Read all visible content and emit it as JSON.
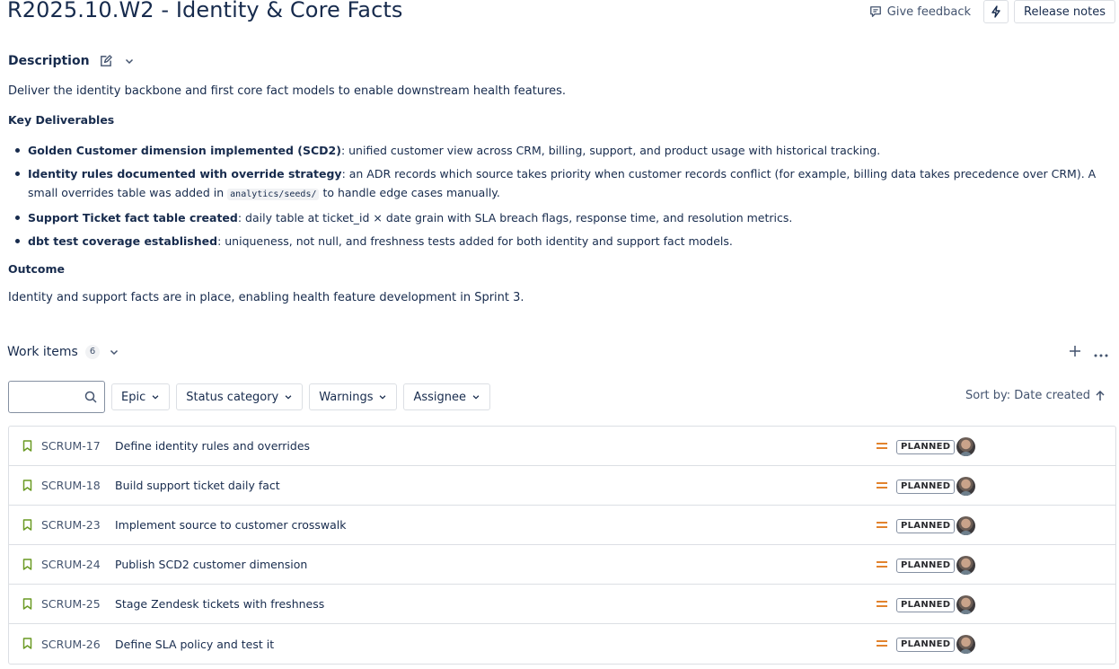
{
  "page": {
    "title": "R2025.10.W2 - Identity & Core Facts",
    "feedback_label": "Give feedback",
    "release_notes_label": "Release notes"
  },
  "description": {
    "label": "Description",
    "intro": "Deliver the identity backbone and first core fact models to enable downstream health features.",
    "key_deliverables_heading": "Key Deliverables",
    "bullets": [
      {
        "bold": "Golden Customer dimension implemented (SCD2)",
        "text": ": unified customer view across CRM, billing, support, and product usage with historical tracking."
      },
      {
        "bold": "Identity rules documented with override strategy",
        "text": ": an ADR records which source takes priority when customer records conflict (for example, billing data takes precedence over CRM). A small overrides table was added in ",
        "code": "analytics/seeds/",
        "text_after": " to handle edge cases manually."
      },
      {
        "bold": "Support Ticket fact table created",
        "text": ": daily table at ticket_id × date grain with SLA breach flags, response time, and resolution metrics."
      },
      {
        "bold": "dbt test coverage established",
        "text": ": uniqueness, not null, and freshness tests added for both identity and support fact models."
      }
    ],
    "outcome_heading": "Outcome",
    "outcome_text": "Identity and support facts are in place, enabling health feature development in Sprint 3."
  },
  "work_items": {
    "title": "Work items",
    "count": "6",
    "search_value": "",
    "filters": [
      "Epic",
      "Status category",
      "Warnings",
      "Assignee"
    ],
    "sort_label": "Sort by: Date created",
    "rows": [
      {
        "key": "SCRUM-17",
        "summary": "Define identity rules and overrides",
        "status": "PLANNED"
      },
      {
        "key": "SCRUM-18",
        "summary": "Build support ticket daily fact",
        "status": "PLANNED"
      },
      {
        "key": "SCRUM-23",
        "summary": "Implement source to customer crosswalk",
        "status": "PLANNED"
      },
      {
        "key": "SCRUM-24",
        "summary": "Publish SCD2 customer dimension",
        "status": "PLANNED"
      },
      {
        "key": "SCRUM-25",
        "summary": "Stage Zendesk tickets with freshness",
        "status": "PLANNED"
      },
      {
        "key": "SCRUM-26",
        "summary": "Define SLA policy and test it",
        "status": "PLANNED"
      }
    ]
  },
  "colors": {
    "story_icon": "#6a9a23",
    "priority_medium": "#e2832e",
    "text": "#172b4d",
    "subtle_text": "#44546f"
  }
}
